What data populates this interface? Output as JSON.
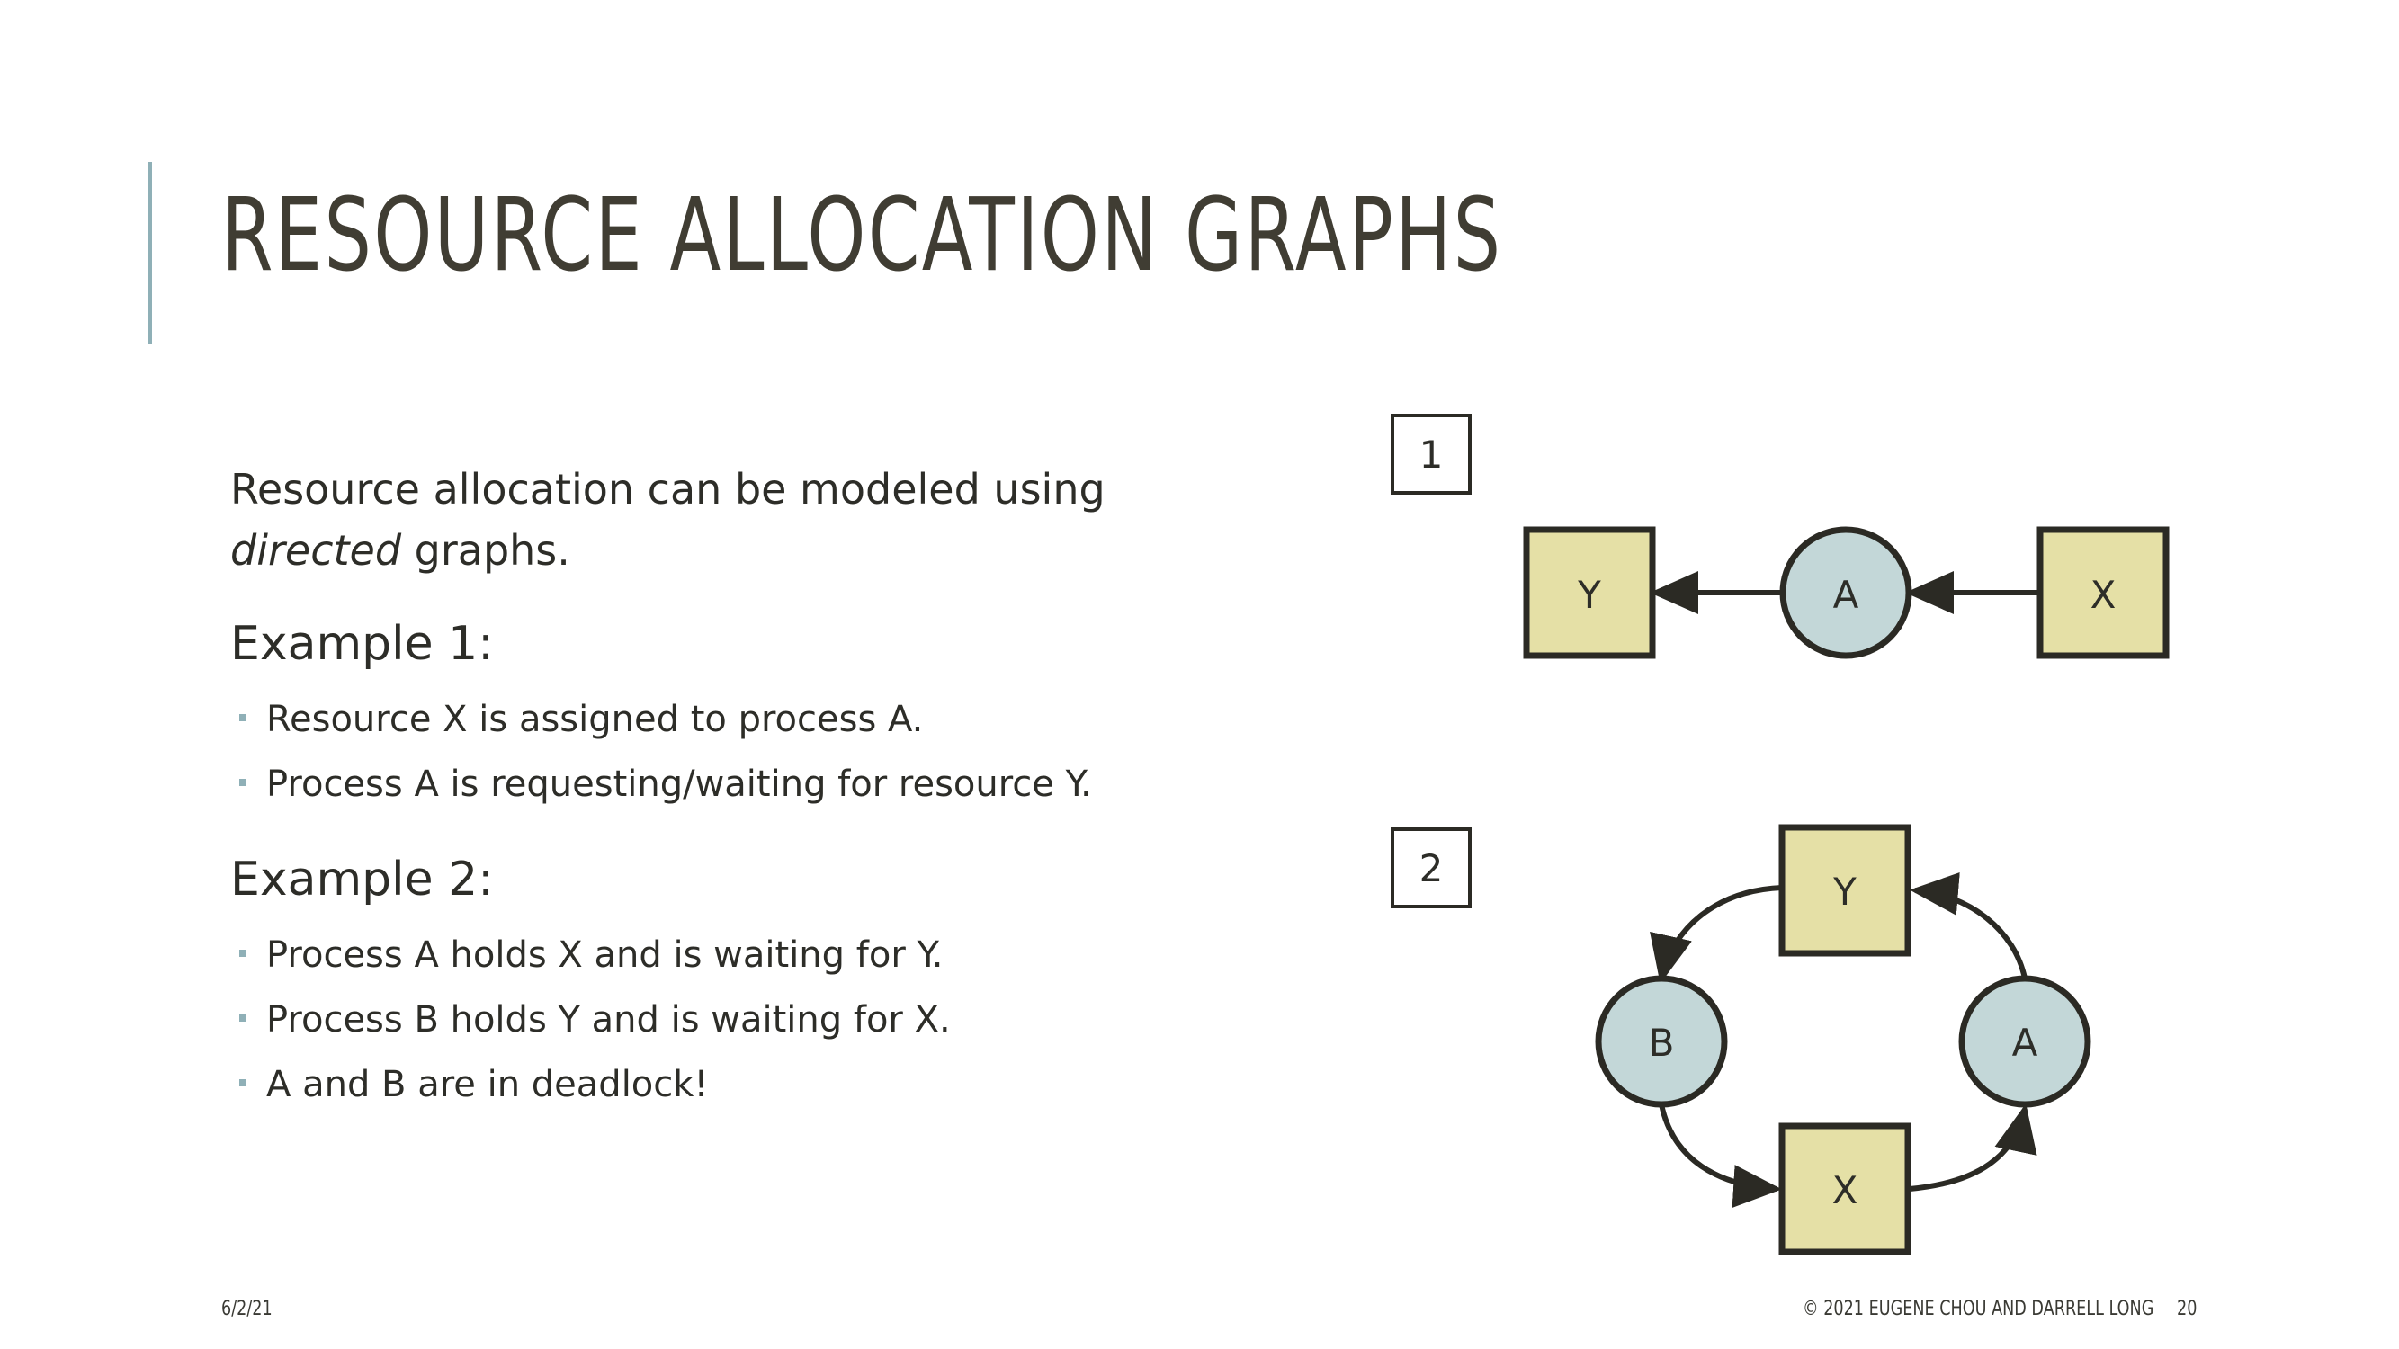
{
  "slide": {
    "title": "RESOURCE ALLOCATION GRAPHS",
    "intro": {
      "part1": "Resource allocation can be modeled using",
      "emphasis": "directed",
      "part2": " graphs."
    },
    "examples": [
      {
        "heading": "Example 1:",
        "bullets": [
          "Resource X is assigned to process A.",
          "Process A is requesting/waiting for resource Y."
        ]
      },
      {
        "heading": "Example 2:",
        "bullets": [
          "Process A holds X and is waiting for Y.",
          "Process B holds Y and is waiting for X.",
          "A and B are in deadlock!"
        ]
      }
    ]
  },
  "diagrams": [
    {
      "label": "1",
      "nodes": {
        "resource_y": "Y",
        "process_a": "A",
        "resource_x": "X"
      }
    },
    {
      "label": "2",
      "nodes": {
        "resource_y": "Y",
        "process_b": "B",
        "process_a": "A",
        "resource_x": "X"
      }
    }
  ],
  "colors": {
    "resource_fill": "#e5e0a6",
    "process_fill": "#c3d7d8",
    "stroke": "#2b2a24",
    "accent": "#8fb0b7"
  },
  "footer": {
    "date": "6/2/21",
    "copyright": "© 2021 EUGENE CHOU AND DARRELL LONG",
    "page": "20"
  }
}
